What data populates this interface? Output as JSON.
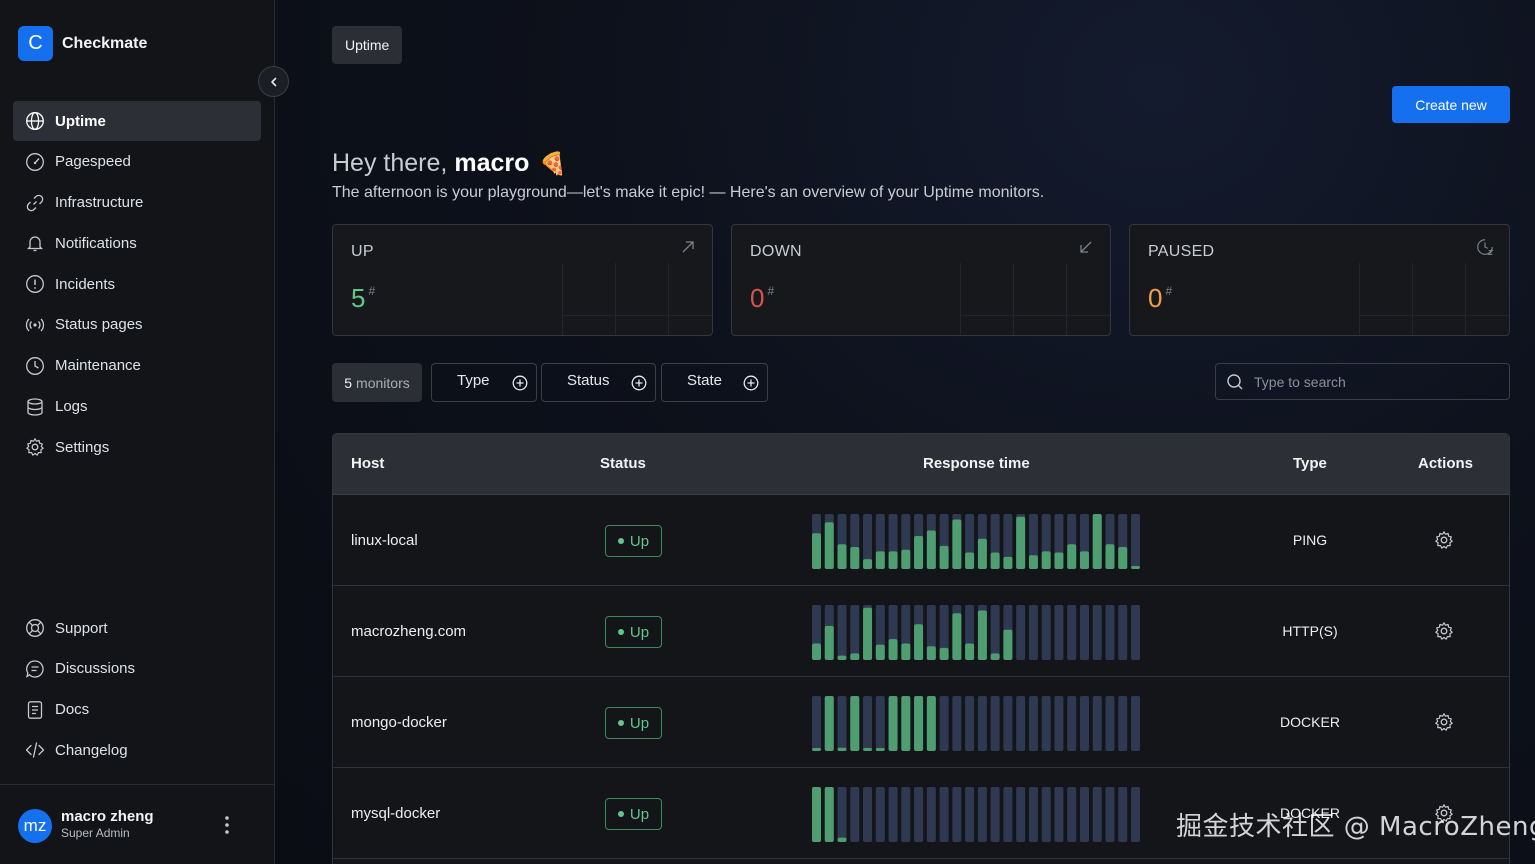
{
  "brand": {
    "logo_letter": "C",
    "name": "Checkmate",
    "accent": "#1570ef"
  },
  "sidebar": {
    "items": [
      {
        "label": "Uptime",
        "icon": "globe-icon",
        "active": true
      },
      {
        "label": "Pagespeed",
        "icon": "gauge-icon"
      },
      {
        "label": "Infrastructure",
        "icon": "link-icon"
      },
      {
        "label": "Notifications",
        "icon": "bell-icon"
      },
      {
        "label": "Incidents",
        "icon": "alert-circle-icon"
      },
      {
        "label": "Status pages",
        "icon": "broadcast-icon"
      },
      {
        "label": "Maintenance",
        "icon": "clock-icon"
      },
      {
        "label": "Logs",
        "icon": "database-icon"
      },
      {
        "label": "Settings",
        "icon": "gear-icon"
      }
    ],
    "bottom_items": [
      {
        "label": "Support",
        "icon": "lifebuoy-icon"
      },
      {
        "label": "Discussions",
        "icon": "chat-icon"
      },
      {
        "label": "Docs",
        "icon": "document-icon"
      },
      {
        "label": "Changelog",
        "icon": "code-icon"
      }
    ],
    "user": {
      "initials": "mz",
      "name": "macro zheng",
      "role": "Super Admin"
    }
  },
  "header": {
    "breadcrumb": "Uptime",
    "create_label": "Create new"
  },
  "greeting": {
    "prefix": "Hey there,",
    "name": "macro",
    "emoji": "🍕",
    "subtitle": "The afternoon is your playground—let's make it epic! — Here's an overview of your Uptime monitors."
  },
  "stats": [
    {
      "label": "UP",
      "value": "5",
      "unit": "#",
      "color": "#5fc88a",
      "icon": "arrow-up-right-icon"
    },
    {
      "label": "DOWN",
      "value": "0",
      "unit": "#",
      "color": "#d9534f",
      "icon": "arrow-down-left-icon"
    },
    {
      "label": "PAUSED",
      "value": "0",
      "unit": "#",
      "color": "#f0a040",
      "icon": "clock-pause-icon"
    }
  ],
  "filters": {
    "count_number": "5",
    "count_label": "monitors",
    "type": "Type",
    "status": "Status",
    "state": "State",
    "search_placeholder": "Type to search"
  },
  "table": {
    "headers": {
      "host": "Host",
      "status": "Status",
      "response": "Response time",
      "type": "Type",
      "actions": "Actions"
    },
    "rows": [
      {
        "host": "linux-local",
        "status": "Up",
        "type": "PING",
        "bars": [
          0.65,
          0.85,
          0.45,
          0.4,
          0.18,
          0.32,
          0.32,
          0.35,
          0.6,
          0.7,
          0.42,
          0.9,
          0.3,
          0.55,
          0.3,
          0.22,
          0.95,
          0.25,
          0.32,
          0.3,
          0.45,
          0.32,
          1.0,
          0.45,
          0.4,
          0.05
        ]
      },
      {
        "host": "macrozheng.com",
        "status": "Up",
        "type": "HTTP(S)",
        "bars": [
          0.3,
          0.62,
          0.08,
          0.12,
          0.95,
          0.28,
          0.38,
          0.3,
          0.65,
          0.25,
          0.22,
          0.85,
          0.3,
          0.9,
          0.12,
          0.55,
          0,
          0,
          0,
          0,
          0,
          0,
          0,
          0,
          0,
          0
        ]
      },
      {
        "host": "mongo-docker",
        "status": "Up",
        "type": "DOCKER",
        "bars": [
          0.05,
          1.0,
          0.06,
          1.0,
          0.05,
          0.05,
          1.0,
          1.0,
          1.0,
          1.0,
          0,
          0,
          0,
          0,
          0,
          0,
          0,
          0,
          0,
          0,
          0,
          0,
          0,
          0,
          0,
          0
        ]
      },
      {
        "host": "mysql-docker",
        "status": "Up",
        "type": "DOCKER",
        "bars": [
          1.0,
          1.0,
          0.08,
          0,
          0,
          0,
          0,
          0,
          0,
          0,
          0,
          0,
          0,
          0,
          0,
          0,
          0,
          0,
          0,
          0,
          0,
          0,
          0,
          0,
          0,
          0
        ]
      }
    ]
  },
  "watermark": "掘金技术社区 @ MacroZheng"
}
